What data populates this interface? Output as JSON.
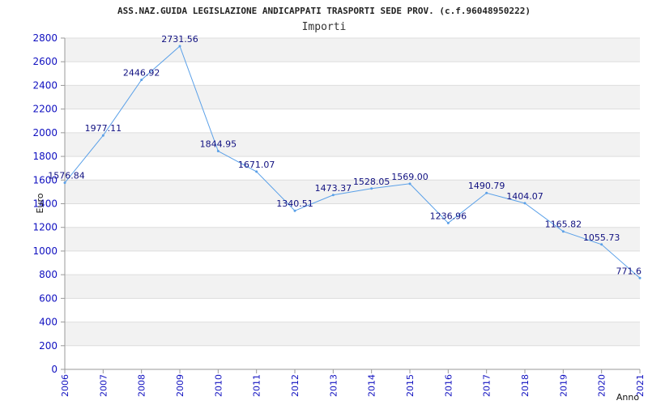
{
  "chart_data": {
    "type": "line",
    "title": "ASS.NAZ.GUIDA LEGISLAZIONE ANDICAPPATI TRASPORTI SEDE PROV. (c.f.96048950222)",
    "subtitle": "Importi",
    "xlabel": "Anno",
    "ylabel": "Euro",
    "categories": [
      "2006",
      "2007",
      "2008",
      "2009",
      "2010",
      "2011",
      "2012",
      "2013",
      "2014",
      "2015",
      "2016",
      "2017",
      "2018",
      "2019",
      "2020",
      "2021"
    ],
    "series": [
      {
        "values": [
          1576.84,
          1977.11,
          2446.92,
          2731.56,
          1844.95,
          1671.07,
          1340.51,
          1473.37,
          1528.05,
          1569.0,
          1236.96,
          1490.79,
          1404.07,
          1165.82,
          1055.73,
          771.6
        ],
        "labels": [
          "1576.84",
          "1977.11",
          "2446.92",
          "2731.56",
          "1844.95",
          "1671.07",
          "1340.51",
          "1473.37",
          "1528.05",
          "1569.00",
          "1236.96",
          "1490.79",
          "1404.07",
          "1165.82",
          "1055.73",
          "771.6"
        ],
        "color": "#5aa0e8"
      }
    ],
    "ylim": [
      0,
      2800
    ],
    "yticks": [
      0,
      200,
      400,
      600,
      800,
      1000,
      1200,
      1400,
      1600,
      1800,
      2000,
      2200,
      2400,
      2600,
      2800
    ],
    "grid": true,
    "band_colors": [
      "#f2f2f2",
      "#ffffff"
    ],
    "tick_color": "#1010c0",
    "label_color": "#101080"
  }
}
